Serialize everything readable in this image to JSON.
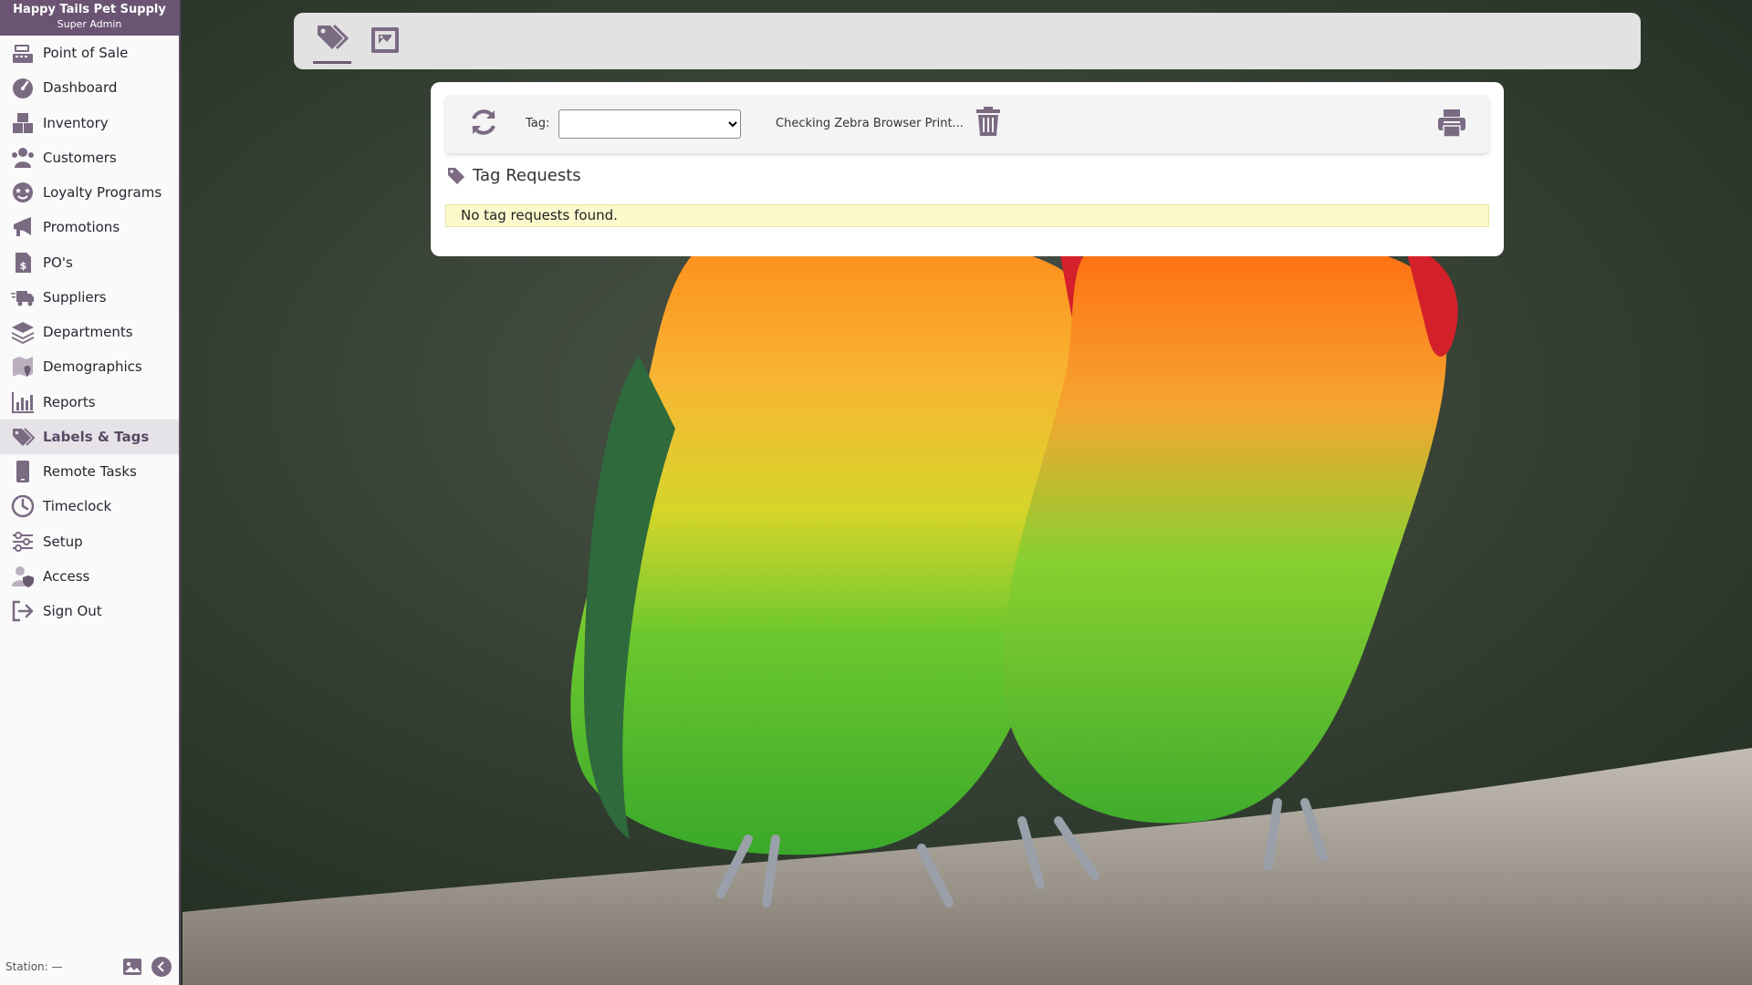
{
  "sidebar": {
    "company": "Happy Tails Pet Supply",
    "role": "Super Admin",
    "items": [
      {
        "label": "Point of Sale",
        "icon": "register-icon",
        "active": false
      },
      {
        "label": "Dashboard",
        "icon": "gauge-icon",
        "active": false
      },
      {
        "label": "Inventory",
        "icon": "boxes-icon",
        "active": false
      },
      {
        "label": "Customers",
        "icon": "people-icon",
        "active": false
      },
      {
        "label": "Loyalty Programs",
        "icon": "star-face-icon",
        "active": false
      },
      {
        "label": "Promotions",
        "icon": "megaphone-icon",
        "active": false
      },
      {
        "label": "PO's",
        "icon": "invoice-dollar-icon",
        "active": false
      },
      {
        "label": "Suppliers",
        "icon": "truck-icon",
        "active": false
      },
      {
        "label": "Departments",
        "icon": "layers-icon",
        "active": false
      },
      {
        "label": "Demographics",
        "icon": "map-pin-icon",
        "active": false
      },
      {
        "label": "Reports",
        "icon": "bar-chart-icon",
        "active": false
      },
      {
        "label": "Labels & Tags",
        "icon": "tags-icon",
        "active": true
      },
      {
        "label": "Remote Tasks",
        "icon": "tablet-icon",
        "active": false
      },
      {
        "label": "Timeclock",
        "icon": "clock-icon",
        "active": false
      },
      {
        "label": "Setup",
        "icon": "sliders-icon",
        "active": false
      },
      {
        "label": "Access",
        "icon": "user-shield-icon",
        "active": false
      },
      {
        "label": "Sign Out",
        "icon": "sign-out-icon",
        "active": false
      }
    ],
    "footer": {
      "station": "Station: —",
      "background_icon": "image-icon",
      "collapse_icon": "chevron-left-icon"
    }
  },
  "topbar": {
    "tabs": [
      {
        "icon": "tags-icon",
        "active": true
      },
      {
        "icon": "image-label-icon",
        "active": false
      }
    ]
  },
  "toolbar": {
    "refresh_icon": "refresh-icon",
    "tag_label": "Tag:",
    "tag_value": "",
    "status": "Checking Zebra Browser Print...",
    "trash_icon": "trash-icon",
    "print_icon": "printer-icon"
  },
  "main": {
    "section_title": "Tag Requests",
    "empty_message": "No tag requests found."
  },
  "colors": {
    "brand": "#6a5472",
    "icon": "#7a6a82",
    "notice_bg": "#fcfacc",
    "active_bg": "#e6e3e8"
  }
}
